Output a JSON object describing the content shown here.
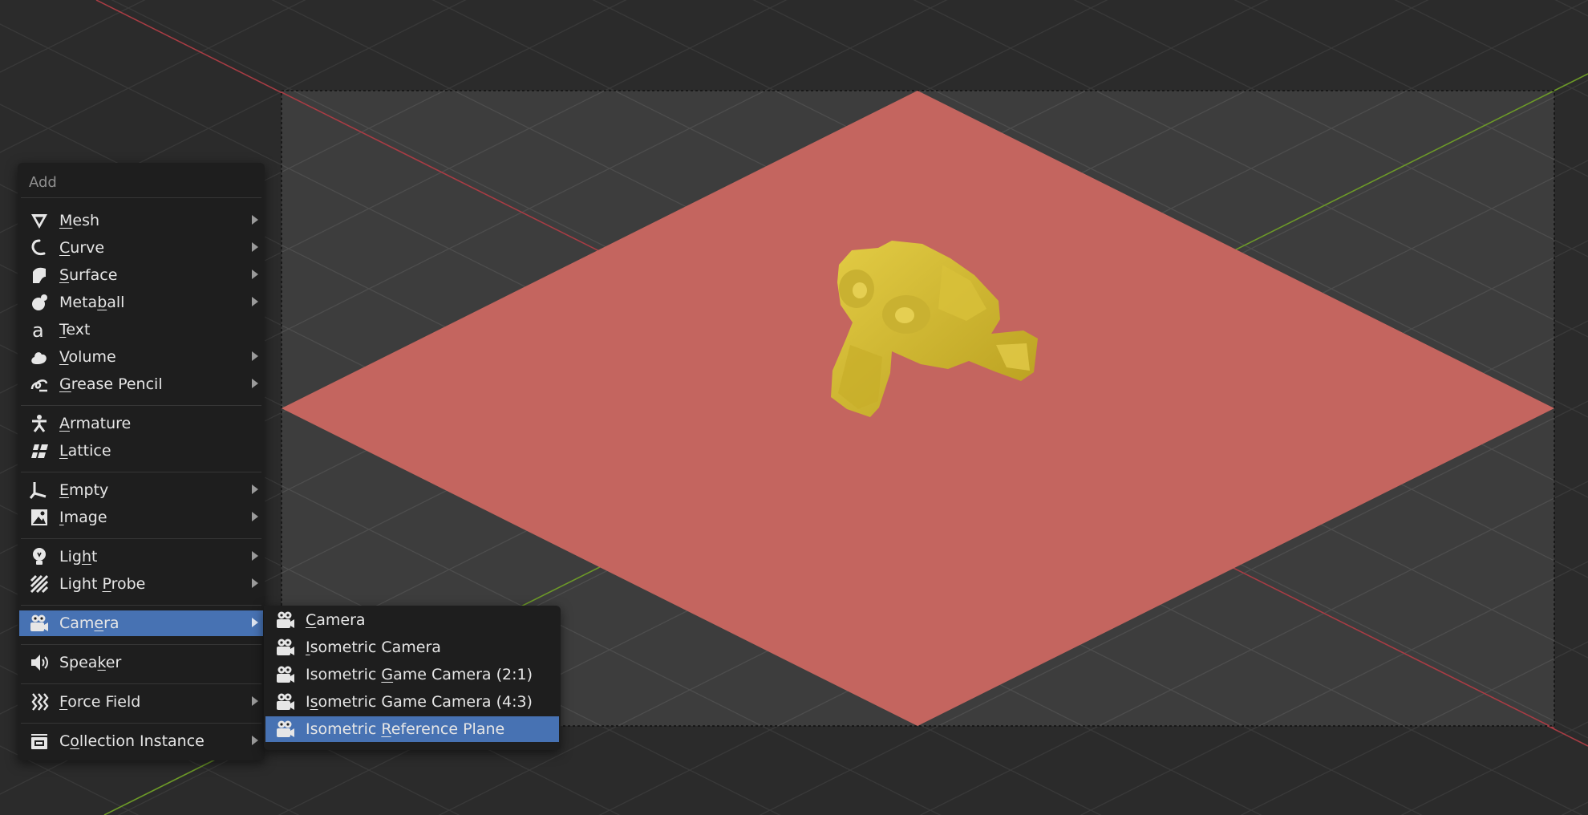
{
  "colors": {
    "background": "#2b2b2b",
    "camera_frame": "#3d3d3d",
    "plane": "#c4655f",
    "monkey": "#d4bc2c",
    "highlight": "#4772b3",
    "x_axis": "#a83c44",
    "y_axis": "#6d9a28"
  },
  "add_menu": {
    "title": "Add",
    "items": [
      {
        "icon": "mesh-icon",
        "pre": "",
        "u": "M",
        "post": "esh",
        "submenu": true
      },
      {
        "icon": "curve-icon",
        "pre": "",
        "u": "C",
        "post": "urve",
        "submenu": true
      },
      {
        "icon": "surface-icon",
        "pre": "",
        "u": "S",
        "post": "urface",
        "submenu": true
      },
      {
        "icon": "metaball-icon",
        "pre": "Meta",
        "u": "b",
        "post": "all",
        "submenu": true
      },
      {
        "icon": "text-icon",
        "pre": "",
        "u": "T",
        "post": "ext",
        "submenu": false
      },
      {
        "icon": "volume-icon",
        "pre": "",
        "u": "V",
        "post": "olume",
        "submenu": true
      },
      {
        "icon": "grease-pencil-icon",
        "pre": "",
        "u": "G",
        "post": "rease Pencil",
        "submenu": true
      },
      {
        "icon": "armature-icon",
        "pre": "",
        "u": "A",
        "post": "rmature",
        "submenu": false
      },
      {
        "icon": "lattice-icon",
        "pre": "",
        "u": "L",
        "post": "attice",
        "submenu": false
      },
      {
        "icon": "empty-icon",
        "pre": "",
        "u": "E",
        "post": "mpty",
        "submenu": true
      },
      {
        "icon": "image-icon",
        "pre": "",
        "u": "I",
        "post": "mage",
        "submenu": true
      },
      {
        "icon": "light-icon",
        "pre": "Lig",
        "u": "h",
        "post": "t",
        "submenu": true
      },
      {
        "icon": "light-probe-icon",
        "pre": "Light ",
        "u": "P",
        "post": "robe",
        "submenu": true
      },
      {
        "icon": "camera-icon",
        "pre": "Cam",
        "u": "e",
        "post": "ra",
        "submenu": true,
        "active": true
      },
      {
        "icon": "speaker-icon",
        "pre": "Spea",
        "u": "k",
        "post": "er",
        "submenu": false
      },
      {
        "icon": "force-field-icon",
        "pre": "",
        "u": "F",
        "post": "orce Field",
        "submenu": true
      },
      {
        "icon": "collection-instance-icon",
        "pre": "C",
        "u": "o",
        "post": "llection Instance",
        "submenu": true
      }
    ]
  },
  "camera_submenu": {
    "items": [
      {
        "icon": "camera-icon",
        "pre": "",
        "u": "C",
        "post": "amera"
      },
      {
        "icon": "camera-icon",
        "pre": "",
        "u": "I",
        "post": "sometric Camera"
      },
      {
        "icon": "camera-icon",
        "pre": "Isometric ",
        "u": "G",
        "post": "ame Camera (2:1)"
      },
      {
        "icon": "camera-icon",
        "pre": "I",
        "u": "s",
        "post": "ometric Game Camera (4:3)"
      },
      {
        "icon": "camera-icon",
        "pre": "Isometric ",
        "u": "R",
        "post": "eference Plane",
        "active": true
      }
    ]
  }
}
